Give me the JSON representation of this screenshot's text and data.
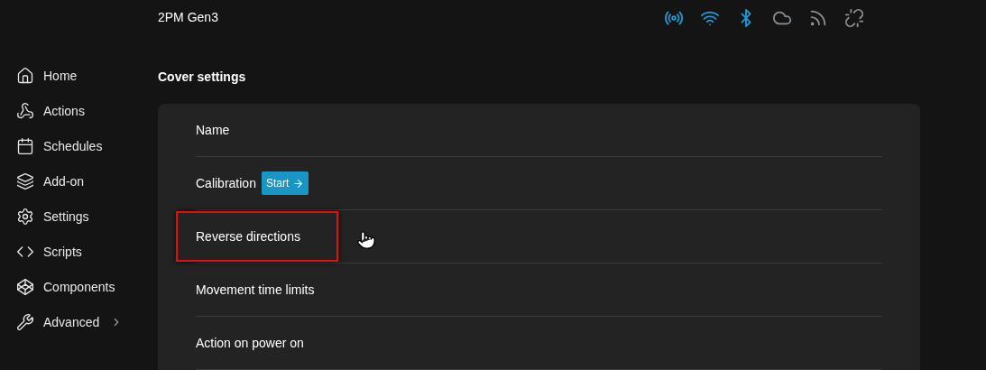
{
  "header": {
    "device_name": "2PM Gen3",
    "status_icons": [
      {
        "kind": "radio",
        "active": true
      },
      {
        "kind": "wifi",
        "active": true
      },
      {
        "kind": "bluetooth",
        "active": true
      },
      {
        "kind": "cloud",
        "active": false
      },
      {
        "kind": "feed",
        "active": false
      },
      {
        "kind": "slashed",
        "active": false
      }
    ]
  },
  "sidebar": {
    "items": [
      {
        "kind": "home",
        "label": "Home",
        "has_submenu": false
      },
      {
        "kind": "actions",
        "label": "Actions",
        "has_submenu": false
      },
      {
        "kind": "schedules",
        "label": "Schedules",
        "has_submenu": false
      },
      {
        "kind": "addon",
        "label": "Add-on",
        "has_submenu": false
      },
      {
        "kind": "settings",
        "label": "Settings",
        "has_submenu": false
      },
      {
        "kind": "scripts",
        "label": "Scripts",
        "has_submenu": false
      },
      {
        "kind": "components",
        "label": "Components",
        "has_submenu": false
      },
      {
        "kind": "advanced",
        "label": "Advanced",
        "has_submenu": true
      }
    ]
  },
  "section": {
    "title": "Cover settings",
    "rows": [
      {
        "label": "Name",
        "highlighted": false,
        "hovered": false
      },
      {
        "label": "Calibration",
        "button": "Start",
        "highlighted": false,
        "hovered": false
      },
      {
        "label": "Reverse directions",
        "highlighted": true,
        "hovered": true
      },
      {
        "label": "Movement time limits",
        "highlighted": false,
        "hovered": false
      },
      {
        "label": "Action on power on",
        "highlighted": false,
        "hovered": false
      }
    ]
  }
}
